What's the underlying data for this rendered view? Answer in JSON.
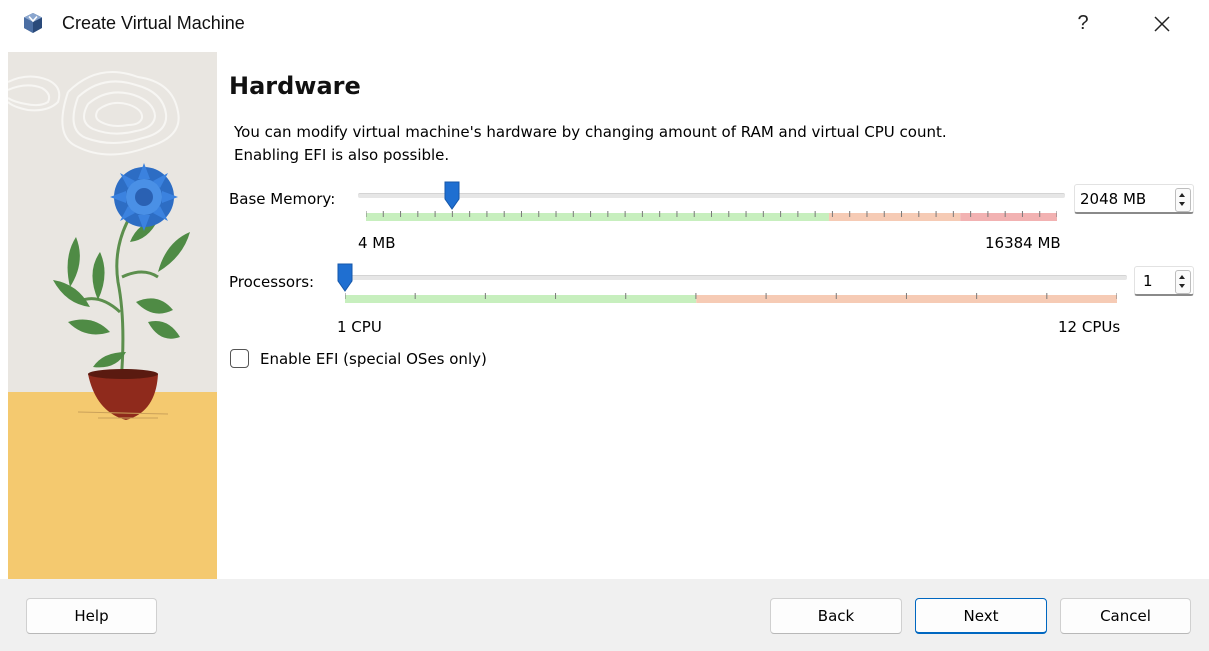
{
  "window": {
    "title": "Create Virtual Machine",
    "help_glyph": "?",
    "close_icon": "close-icon"
  },
  "page": {
    "heading": "Hardware",
    "description_line1": "You can modify virtual machine's hardware by changing amount of RAM and virtual CPU count.",
    "description_line2": "Enabling EFI is also possible."
  },
  "memory": {
    "label": "Base Memory:",
    "value": 2048,
    "value_text": "2048 MB",
    "min_label": "4 MB",
    "max_label": "16384 MB",
    "min": 4,
    "max": 16384,
    "zones": [
      {
        "name": "optimal",
        "color": "#c7efbe",
        "until_fraction": 0.67
      },
      {
        "name": "warning",
        "color": "#f6cbb5",
        "until_fraction": 0.86
      },
      {
        "name": "critical",
        "color": "#f2b2b2",
        "until_fraction": 1.0
      }
    ]
  },
  "processors": {
    "label": "Processors:",
    "value": 1,
    "value_text": "1",
    "min_label": "1 CPU",
    "max_label": "12 CPUs",
    "min": 1,
    "max": 12,
    "zones": [
      {
        "name": "optimal",
        "color": "#c7efbe",
        "until_fraction": 0.455
      },
      {
        "name": "warning",
        "color": "#f6cbb5",
        "until_fraction": 1.0
      }
    ]
  },
  "efi": {
    "label": "Enable EFI (special OSes only)",
    "checked": false
  },
  "buttons": {
    "help": "Help",
    "back": "Back",
    "next": "Next",
    "cancel": "Cancel"
  },
  "colors": {
    "accent": "#0067c0",
    "handle": "#1f6fd1"
  }
}
